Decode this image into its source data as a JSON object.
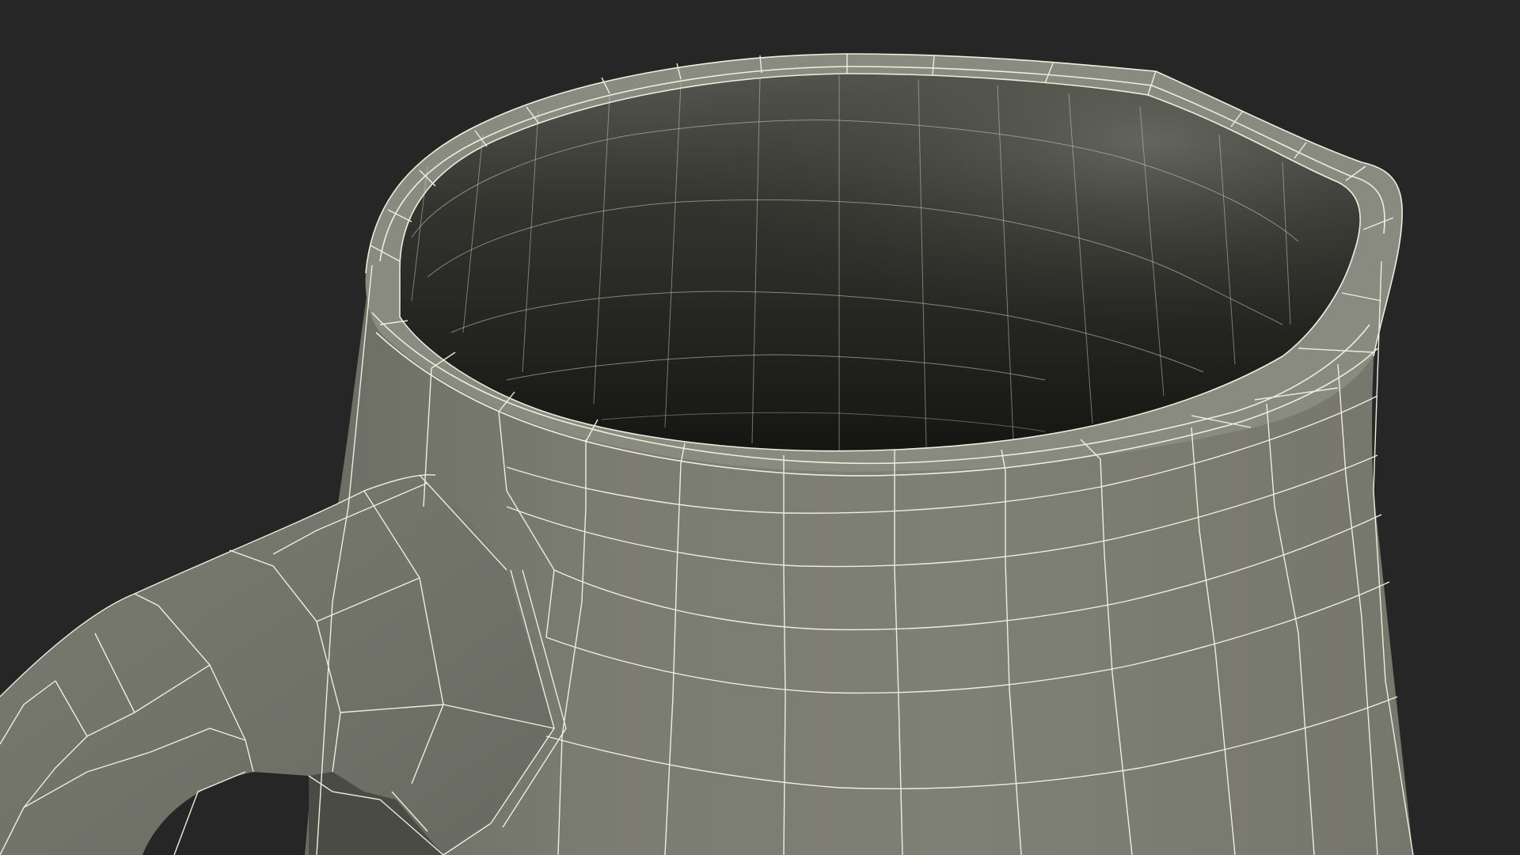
{
  "scene": {
    "subject": "pitcher-wireframe-render",
    "colors": {
      "background": "#262626",
      "body_light": "#84857a",
      "body_mid": "#7a7b70",
      "body_dark": "#5f6058",
      "rim": "#8a8b80",
      "inside_top": "#4a4b44",
      "inside_bottom": "#161714",
      "handle": "#75766c",
      "wire": "#eeeedd"
    }
  }
}
